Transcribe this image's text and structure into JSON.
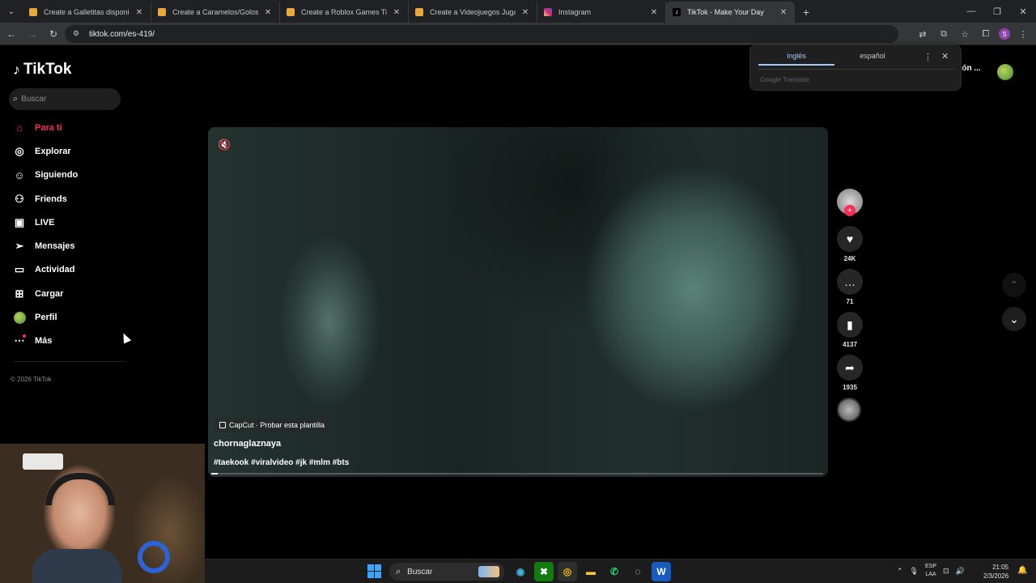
{
  "browser": {
    "tabs": [
      {
        "label": "Create a Galletitas disponibles",
        "favicon_color": "#e8a93a"
      },
      {
        "label": "Create a Caramelos/Golosinas",
        "favicon_color": "#e8a93a"
      },
      {
        "label": "Create a Roblox Games Tier List",
        "favicon_color": "#e8a93a"
      },
      {
        "label": "Create a Videojuegos Jugados",
        "favicon_color": "#e8a93a"
      },
      {
        "label": "Instagram",
        "favicon_color": "#d62976"
      },
      {
        "label": "TikTok - Make Your Day",
        "favicon_color": "#ffffff"
      }
    ],
    "url": "tiktok.com/es-419/",
    "profile_initial": "S"
  },
  "translate_popup": {
    "lang_from": "inglés",
    "lang_to": "español",
    "brand": "Google Translate"
  },
  "tiktok": {
    "logo": "TikTok",
    "search_placeholder": "Buscar",
    "nav": [
      {
        "label": "Para ti",
        "icon": "home-icon"
      },
      {
        "label": "Explorar",
        "icon": "compass-icon"
      },
      {
        "label": "Siguiendo",
        "icon": "following-icon"
      },
      {
        "label": "Friends",
        "icon": "friends-icon"
      },
      {
        "label": "LIVE",
        "icon": "live-icon"
      },
      {
        "label": "Mensajes",
        "icon": "messages-icon"
      },
      {
        "label": "Actividad",
        "icon": "activity-icon"
      },
      {
        "label": "Cargar",
        "icon": "upload-icon"
      },
      {
        "label": "Perfil",
        "icon": "profile-avatar"
      },
      {
        "label": "Más",
        "icon": "more-icon"
      }
    ],
    "copyright": "© 2026 TikTok",
    "header_right_text": "ción ...",
    "accent_color": "#fe2c55"
  },
  "video": {
    "capcut_label": "CapCut · Probar esta plantilla",
    "author": "chornaglaznaya",
    "hashtags": "#taekook #viralvideo #jk #mlm #bts",
    "likes": "24K",
    "comments": "71",
    "saves": "4137",
    "shares": "1935"
  },
  "taskbar": {
    "search_placeholder": "Buscar",
    "lang_line1": "ESP",
    "lang_line2": "LAA",
    "time": "21:05",
    "date": "2/3/2026"
  }
}
